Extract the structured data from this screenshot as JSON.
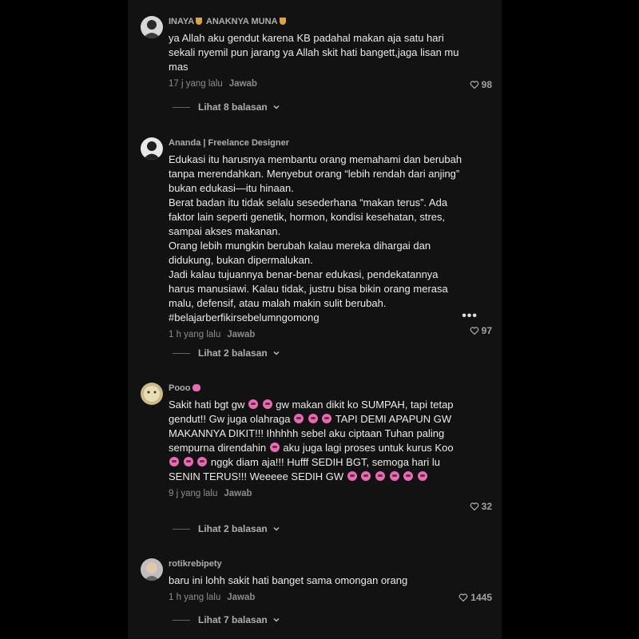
{
  "comments": [
    {
      "name_a": "INAYA",
      "name_b": "ANAKNYA MUNA",
      "text": [
        "ya Allah aku gendut karena KB padahal makan aja satu hari sekali nyemil pun jarang ya Allah skit hati bangett,jaga lisan mu mas"
      ],
      "time": "17 j yang lalu",
      "reply": "Jawab",
      "likes": "98",
      "view_replies": "Lihat 8 balasan"
    },
    {
      "name": "Ananda | Freelance Designer",
      "text": [
        "Edukasi itu harusnya membantu orang memahami dan berubah tanpa merendahkan. Menyebut orang “lebih rendah dari anjing” bukan edukasi—itu hinaan.",
        "Berat badan itu tidak selalu sesederhana “makan terus”. Ada faktor lain seperti genetik, hormon, kondisi kesehatan, stres, sampai akses makanan.",
        "Orang lebih mungkin berubah kalau mereka dihargai dan didukung, bukan dipermalukan.",
        "Jadi kalau tujuannya benar-benar edukasi, pendekatannya harus manusiawi. Kalau tidak, justru bisa bikin orang merasa malu, defensif, atau malah makin sulit berubah. #belajarberfikirsebelumngomong"
      ],
      "more": "•••",
      "time": "1 h yang lalu",
      "reply": "Jawab",
      "likes": "97",
      "view_replies": "Lihat 2 balasan"
    },
    {
      "name": "Pooo",
      "text_parts": [
        "Sakit hati bgt gw ",
        " gw makan dikit ko SUMPAH, tapi tetap gendut!! Gw juga olahraga ",
        " TAPI DEMI APAPUN GW MAKANNYA DIKIT!!! Ihhhhh sebel aku ciptaan Tuhan paling sempurna direndahin ",
        " aku juga lagi proses untuk kurus Koo",
        " nggk diam aja!!! Hufff SEDIH BGT, semoga hari lu SENIN TERUS!!! Weeeee SEDIH GW "
      ],
      "time": "9 j yang lalu",
      "reply": "Jawab",
      "likes": "32",
      "view_replies": "Lihat 2 balasan"
    },
    {
      "name": "rotikrebipety",
      "text": [
        "baru ini lohh sakit hati banget sama omongan orang"
      ],
      "time": "1 h yang lalu",
      "reply": "Jawab",
      "likes": "1445",
      "view_replies": "Lihat 7 balasan"
    }
  ],
  "colors": {
    "background": "#000000",
    "panel": "#121212",
    "emoji": "#e86ab0"
  }
}
